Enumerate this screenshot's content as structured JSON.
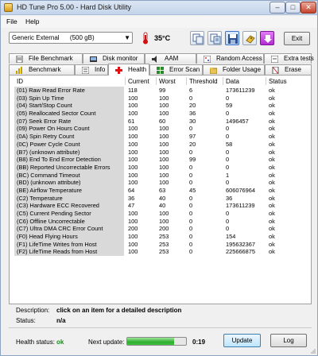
{
  "window": {
    "title": "HD Tune Pro 5.00 - Hard Disk Utility",
    "minimize": "–",
    "maximize": "□",
    "close": "✕"
  },
  "menu": {
    "file": "File",
    "help": "Help"
  },
  "toolbar": {
    "drive": "Generic External      (500 gB)",
    "temperature": "35°C",
    "exit_label": "Exit",
    "buttons": [
      "copy-icon",
      "copy-all-icon",
      "save-icon",
      "options-icon",
      "download-icon"
    ],
    "colors": {
      "save_selected": "#3b6fc8",
      "download": "#b32bd3"
    }
  },
  "tabs_top": [
    {
      "label": "File Benchmark",
      "icon": "file-icon"
    },
    {
      "label": "Disk monitor",
      "icon": "disk-monitor-icon"
    },
    {
      "label": "AAM",
      "icon": "speaker-icon"
    },
    {
      "label": "Random Access",
      "icon": "random-access-icon"
    },
    {
      "label": "Extra tests",
      "icon": "extra-tests-icon"
    }
  ],
  "tabs_bottom": [
    {
      "label": "Benchmark",
      "icon": "benchmark-icon"
    },
    {
      "label": "Info",
      "icon": "info-icon"
    },
    {
      "label": "Health",
      "icon": "health-cross-icon",
      "active": true
    },
    {
      "label": "Error Scan",
      "icon": "error-scan-icon"
    },
    {
      "label": "Folder Usage",
      "icon": "folder-icon"
    },
    {
      "label": "Erase",
      "icon": "erase-icon"
    }
  ],
  "table": {
    "headers": {
      "id": "ID",
      "current": "Current",
      "worst": "Worst",
      "threshold": "Threshold",
      "data": "Data",
      "status": "Status"
    },
    "rows": [
      [
        "(01) Raw Read Error Rate",
        "118",
        "99",
        "6",
        "173611239",
        "ok"
      ],
      [
        "(03) Spin Up Time",
        "100",
        "100",
        "0",
        "0",
        "ok"
      ],
      [
        "(04) Start/Stop Count",
        "100",
        "100",
        "20",
        "59",
        "ok"
      ],
      [
        "(05) Reallocated Sector Count",
        "100",
        "100",
        "36",
        "0",
        "ok"
      ],
      [
        "(07) Seek Error Rate",
        "61",
        "60",
        "30",
        "1496457",
        "ok"
      ],
      [
        "(09) Power On Hours Count",
        "100",
        "100",
        "0",
        "0",
        "ok"
      ],
      [
        "(0A) Spin Retry Count",
        "100",
        "100",
        "97",
        "0",
        "ok"
      ],
      [
        "(0C) Power Cycle Count",
        "100",
        "100",
        "20",
        "58",
        "ok"
      ],
      [
        "(B7) (unknown attribute)",
        "100",
        "100",
        "0",
        "0",
        "ok"
      ],
      [
        "(B8) End To End Error Detection",
        "100",
        "100",
        "99",
        "0",
        "ok"
      ],
      [
        "(BB) Reported Uncorrectable Errors",
        "100",
        "100",
        "0",
        "0",
        "ok"
      ],
      [
        "(BC) Command Timeout",
        "100",
        "100",
        "0",
        "1",
        "ok"
      ],
      [
        "(BD) (unknown attribute)",
        "100",
        "100",
        "0",
        "0",
        "ok"
      ],
      [
        "(BE) Airflow Temperature",
        "64",
        "63",
        "45",
        "606076964",
        "ok"
      ],
      [
        "(C2) Temperature",
        "36",
        "40",
        "0",
        "36",
        "ok"
      ],
      [
        "(C3) Hardware ECC Recovered",
        "47",
        "40",
        "0",
        "173611239",
        "ok"
      ],
      [
        "(C5) Current Pending Sector",
        "100",
        "100",
        "0",
        "0",
        "ok"
      ],
      [
        "(C6) Offline Uncorrectable",
        "100",
        "100",
        "0",
        "0",
        "ok"
      ],
      [
        "(C7) Ultra DMA CRC Error Count",
        "200",
        "200",
        "0",
        "0",
        "ok"
      ],
      [
        "(F0) Head Flying Hours",
        "100",
        "253",
        "0",
        "154",
        "ok"
      ],
      [
        "(F1) LifeTime Writes from Host",
        "100",
        "253",
        "0",
        "195632367",
        "ok"
      ],
      [
        "(F2) LifeTime Reads from Host",
        "100",
        "253",
        "0",
        "225666875",
        "ok"
      ]
    ]
  },
  "details": {
    "description_label": "Description:",
    "description_value": "click on an item for a detailed description",
    "status_label": "Status:",
    "status_value": "n/a"
  },
  "footer": {
    "health_label": "Health status:",
    "health_value": "ok",
    "next_update_label": "Next update:",
    "progress_fraction": 0.8,
    "timer": "0:19",
    "update_label": "Update",
    "log_label": "Log"
  }
}
